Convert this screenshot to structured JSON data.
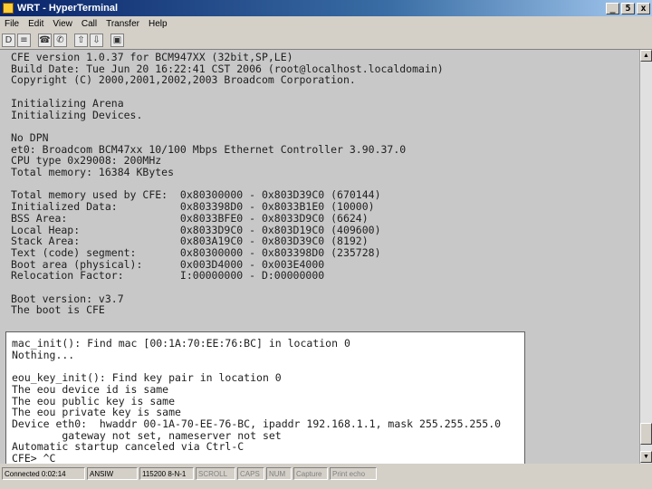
{
  "window": {
    "title": "WRT - HyperTerminal",
    "minimize": "_",
    "maximize": "5",
    "close": "x"
  },
  "menu": [
    "File",
    "Edit",
    "View",
    "Call",
    "Transfer",
    "Help"
  ],
  "toolbar": {
    "new": "D",
    "open": "≡",
    "connect": "☎",
    "disconnect": "✆",
    "send": "⇧",
    "receive": "⇩",
    "properties": "▣"
  },
  "terminal": {
    "text": "CFE version 1.0.37 for BCM947XX (32bit,SP,LE)\nBuild Date: Tue Jun 20 16:22:41 CST 2006 (root@localhost.localdomain)\nCopyright (C) 2000,2001,2002,2003 Broadcom Corporation.\n\nInitializing Arena\nInitializing Devices.\n\nNo DPN\net0: Broadcom BCM47xx 10/100 Mbps Ethernet Controller 3.90.37.0\nCPU type 0x29008: 200MHz\nTotal memory: 16384 KBytes\n\nTotal memory used by CFE:  0x80300000 - 0x803D39C0 (670144)\nInitialized Data:          0x803398D0 - 0x8033B1E0 (10000)\nBSS Area:                  0x8033BFE0 - 0x8033D9C0 (6624)\nLocal Heap:                0x8033D9C0 - 0x803D19C0 (409600)\nStack Area:                0x803A19C0 - 0x803D39C0 (8192)\nText (code) segment:       0x80300000 - 0x803398D0 (235728)\nBoot area (physical):      0x003D4000 - 0x003E4000\nRelocation Factor:         I:00000000 - D:00000000\n\nBoot version: v3.7\nThe boot is CFE"
  },
  "overlay": {
    "text": "mac_init(): Find mac [00:1A:70:EE:76:BC] in location 0\nNothing...\n\neou_key_init(): Find key pair in location 0\nThe eou device id is same\nThe eou public key is same\nThe eou private key is same\nDevice eth0:  hwaddr 00-1A-70-EE-76-BC, ipaddr 192.168.1.1, mask 255.255.255.0\n        gateway not set, nameserver not set\nAutomatic startup canceled via Ctrl-C\nCFE> ^C"
  },
  "status": {
    "connected": "Connected 0:02:14",
    "emulation": "ANSIW",
    "settings": "115200 8-N-1",
    "scroll": "SCROLL",
    "caps": "CAPS",
    "num": "NUM",
    "capture": "Capture",
    "printecho": "Print echo"
  }
}
